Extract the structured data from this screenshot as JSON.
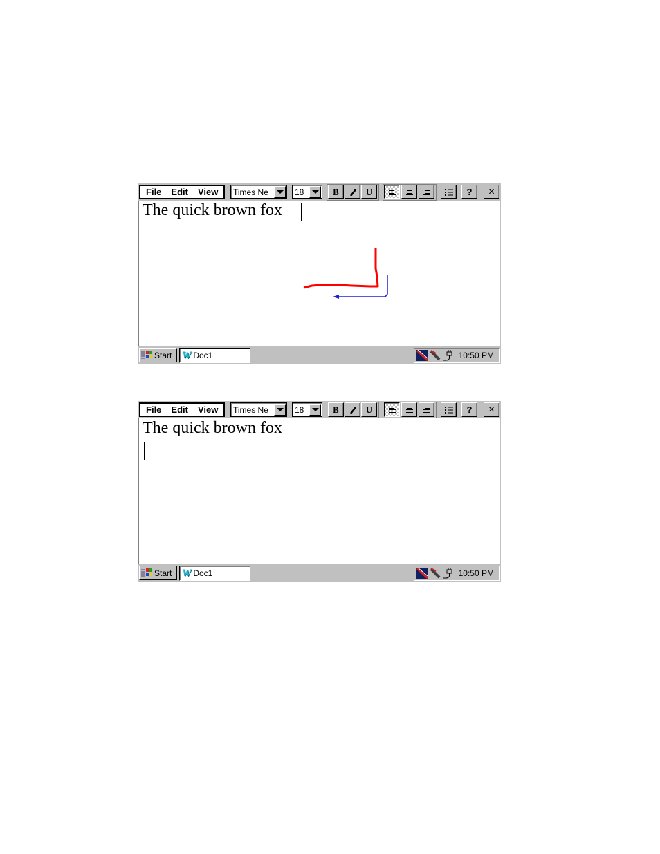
{
  "screens": [
    {
      "menu": {
        "file": "File",
        "edit": "Edit",
        "view": "View",
        "file_key": "F",
        "file_rest": "ile",
        "edit_key": "E",
        "edit_rest": "dit",
        "view_key": "V",
        "view_rest": "iew"
      },
      "font_combo": "Times Ne",
      "size_combo": "18",
      "buttons": {
        "bold": "B",
        "italic": "I",
        "underline": "U",
        "help": "?",
        "close": "×"
      },
      "document_text": "The quick brown fox",
      "taskbar": {
        "start": "Start",
        "task": "Doc1",
        "clock": "10:50 PM"
      },
      "ink_strokes": [
        {
          "color": "#ff0000",
          "description": "red L-shaped pen stroke (down then left)"
        },
        {
          "color": "#2020d0",
          "description": "blue arrow stroke (down then left, arrowhead)"
        }
      ]
    },
    {
      "menu": {
        "file": "File",
        "edit": "Edit",
        "view": "View",
        "file_key": "F",
        "file_rest": "ile",
        "edit_key": "E",
        "edit_rest": "dit",
        "view_key": "V",
        "view_rest": "iew"
      },
      "font_combo": "Times Ne",
      "size_combo": "18",
      "buttons": {
        "bold": "B",
        "italic": "I",
        "underline": "U",
        "help": "?",
        "close": "×"
      },
      "document_text": "The quick brown fox",
      "taskbar": {
        "start": "Start",
        "task": "Doc1",
        "clock": "10:50 PM"
      }
    }
  ],
  "icons": {
    "align_left": "align-left-icon",
    "align_center": "align-center-icon",
    "align_right": "align-right-icon",
    "bullets": "bullet-list-icon",
    "start": "windows-flag-icon",
    "task": "word-w-icon",
    "tray": [
      "connection-icon",
      "pen-icon",
      "power-plug-icon"
    ]
  },
  "colors": {
    "ink_red": "#ff0000",
    "ink_blue": "#2020d0",
    "taskbar": "#c0c0c0",
    "accent_w": "#14b6c8"
  }
}
